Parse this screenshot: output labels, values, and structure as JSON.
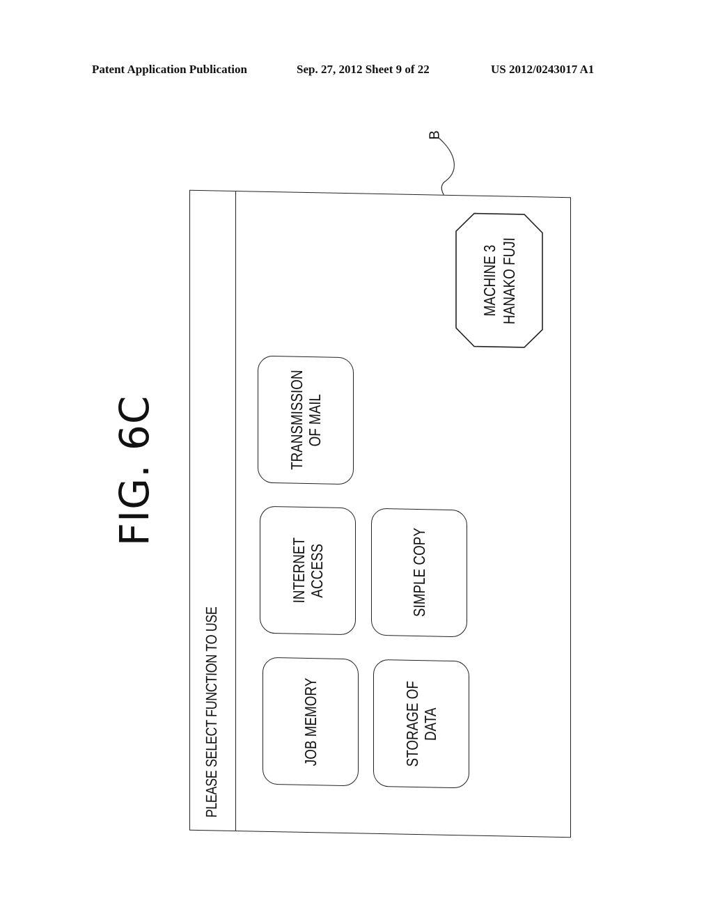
{
  "header": {
    "publication": "Patent Application Publication",
    "date_sheet": "Sep. 27, 2012   Sheet 9 of 22",
    "patent_number": "US 2012/0243017 A1"
  },
  "figure": {
    "label": "FIG. 6C",
    "reference_label": "B"
  },
  "screen": {
    "title": "PLEASE SELECT FUNCTION TO USE",
    "buttons": [
      {
        "label": "JOB MEMORY"
      },
      {
        "label": "INTERNET\nACCESS"
      },
      {
        "label": "TRANSMISSION\nOF MAIL"
      },
      {
        "label": "STORAGE OF\nDATA"
      },
      {
        "label": "SIMPLE COPY"
      }
    ],
    "machine_badge": {
      "label": "MACHINE 3\nHANAKO FUJI"
    }
  }
}
